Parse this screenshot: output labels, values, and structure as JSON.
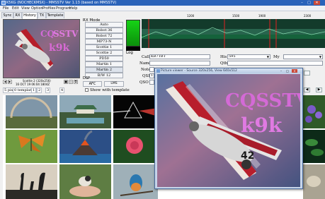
{
  "window": {
    "title": "K5KG (NOCHECKMSX) - MMSSTV Ver 1.13 (based on MMSSTV)",
    "minimize": "–",
    "maximize": "□",
    "close": "✕"
  },
  "menu": [
    "File",
    "Edit",
    "View",
    "Option",
    "Profiles",
    "Program",
    "Help"
  ],
  "tabs": [
    "Sync",
    "RX",
    "History",
    "TX",
    "Template"
  ],
  "preview": {
    "nav_prev": "◀",
    "nav_next": "▶",
    "caption": "Scottie 2 (320x256)",
    "timestamp": "16 OCT 19 06:04 1804Z",
    "image_text": "CQSSTV k9k"
  },
  "rx_mode": {
    "title": "RX Mode",
    "modes": [
      "Auto",
      "Robot 36",
      "Robot 72",
      "MP73-N",
      "Scottie 1",
      "Scottie 2",
      "PD50",
      "Martin 1",
      "Martin 2",
      "B/W 12"
    ]
  },
  "dsp": {
    "title": "DSP",
    "afc": "AFC",
    "lms": "LMS"
  },
  "spectrum": {
    "scale": [
      "1200",
      "1500",
      "1900",
      "2300"
    ]
  },
  "log": {
    "title": "Log",
    "call_label": "Call",
    "call_value": "KB7TBT",
    "his_label": "His",
    "his_value": "595",
    "my_label": "My",
    "name_label": "Name",
    "qth_label": "Qth",
    "note_label": "Note",
    "qsl_label": "QSL",
    "qsl_value": "11",
    "qso_label": "QSO"
  },
  "templates": {
    "tab_name": "5 pix",
    "tab_count": "0 templates",
    "page_1": "1",
    "page_2": "2",
    "page_3": "3",
    "page_4": "4",
    "show_with_template": "Show with template"
  },
  "viewer": {
    "title": "Picture viewer - Source 320x256, View 640x512",
    "image_text_1": "CQSSTV",
    "image_text_2": "k9k",
    "image_number": "42",
    "minimize": "–",
    "maximize": "□",
    "close": "✕"
  },
  "gallery": {
    "items": [
      "rainbow-landscape",
      "pavilion-lake",
      "prism-rainbow",
      "butterfly",
      "volcano-island",
      "pink-rose",
      "birds-silhouette-sunset",
      "bird-on-hand",
      "kingfisher-bird",
      "purple-flowers",
      "lily-pads",
      "seashell-rock"
    ]
  }
}
